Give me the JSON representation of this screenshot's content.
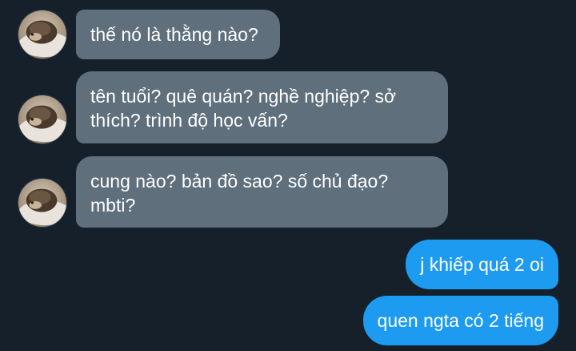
{
  "conversation": {
    "incoming": [
      {
        "lines": [
          "thế nó là thằng nào?"
        ]
      },
      {
        "lines": [
          "tên tuổi? quê quán? nghề nghiệp? sở",
          "thích? trình độ học vấn?"
        ]
      },
      {
        "lines": [
          "cung nào? bản đồ sao? số chủ đạo?",
          "mbti?"
        ]
      }
    ],
    "outgoing": [
      {
        "lines": [
          "j khiếp quá 2 oi"
        ]
      },
      {
        "lines": [
          "quen ngta có 2 tiếng"
        ]
      }
    ]
  },
  "sender_avatar_icon": "hedgehog-avatar",
  "colors": {
    "background": "#15202b",
    "incoming_bubble": "#5f6f7c",
    "outgoing_bubble": "#1d9bf0",
    "text": "#ffffff"
  }
}
